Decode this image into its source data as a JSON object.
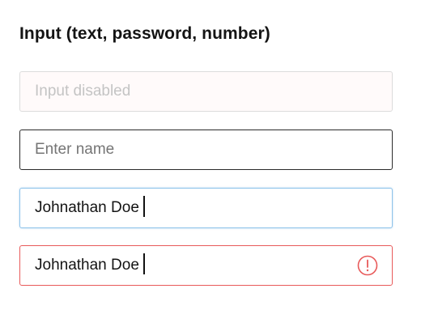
{
  "heading": "Input (text, password, number)",
  "inputs": [
    {
      "state": "disabled",
      "placeholder": "Input disabled",
      "value": ""
    },
    {
      "state": "default",
      "placeholder": "Enter name",
      "value": ""
    },
    {
      "state": "focused",
      "placeholder": "",
      "value": "Johnathan Doe"
    },
    {
      "state": "error",
      "placeholder": "",
      "value": "Johnathan Doe"
    }
  ],
  "colors": {
    "focus_border": "#8ec3ea",
    "error": "#e85a5a",
    "default_border": "#2b2b2b",
    "disabled_bg": "#fffafa"
  },
  "icons": {
    "error": "error-exclamation-circle-icon"
  }
}
